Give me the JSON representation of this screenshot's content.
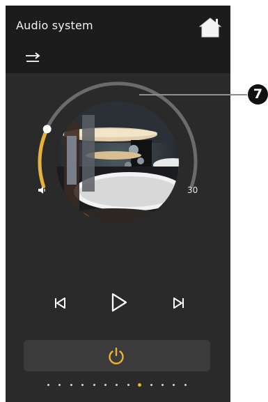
{
  "header": {
    "title": "Audio system",
    "home_icon": "home-icon",
    "source_icon": "swap-arrows-icon"
  },
  "player": {
    "album_art": "drum-kit-photo",
    "volume_level": 0.2,
    "volume_min_icon": "speaker-icon",
    "volume_max_label": "30",
    "controls": [
      "previous-icon",
      "play-icon",
      "next-icon"
    ]
  },
  "power": {
    "icon": "power-icon"
  },
  "pagination": {
    "count": 13,
    "active_index": 8
  },
  "callout": {
    "label": "7"
  },
  "colors": {
    "background": "#2b2a2a",
    "header": "#1d1c1c",
    "accent": "#e8b23a",
    "track": "#6b6b6b",
    "text": "#f2f2f2"
  }
}
